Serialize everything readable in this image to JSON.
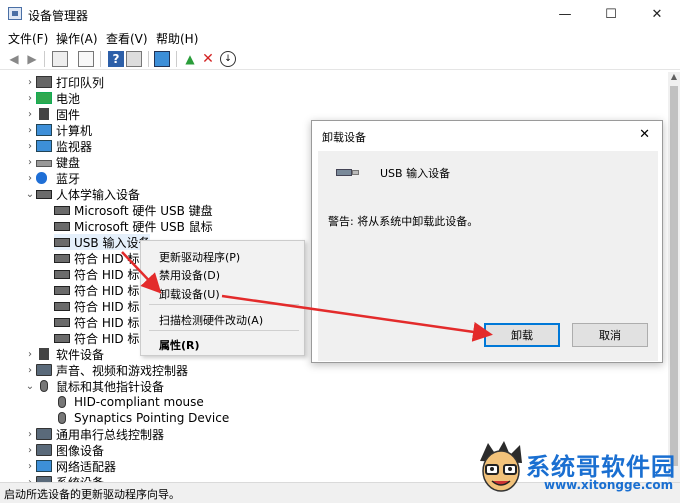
{
  "window": {
    "title": "设备管理器",
    "minimize_glyph": "—",
    "maximize_glyph": "☐",
    "close_glyph": "✕"
  },
  "menubar": {
    "items": [
      "文件(F)",
      "操作(A)",
      "查看(V)",
      "帮助(H)"
    ]
  },
  "toolbar": {
    "buttons": [
      "back-icon",
      "forward-icon",
      "properties-icon",
      "console-icon",
      "help-icon",
      "update-driver-icon",
      "monitor-icon",
      "enable-icon",
      "uninstall-icon",
      "disable-icon"
    ]
  },
  "tree": {
    "rows": [
      {
        "label": "打印队列",
        "expander": "›",
        "icon": "printer-icon"
      },
      {
        "label": "电池",
        "expander": "›",
        "icon": "battery-icon"
      },
      {
        "label": "固件",
        "expander": "›",
        "icon": "firmware-icon"
      },
      {
        "label": "计算机",
        "expander": "›",
        "icon": "computer-icon"
      },
      {
        "label": "监视器",
        "expander": "›",
        "icon": "monitor-icon"
      },
      {
        "label": "键盘",
        "expander": "›",
        "icon": "keyboard-icon"
      },
      {
        "label": "蓝牙",
        "expander": "›",
        "icon": "bluetooth-icon"
      },
      {
        "label": "人体学输入设备",
        "expander": "⌄",
        "icon": "hid-icon"
      },
      {
        "label": "Microsoft 硬件 USB 键盘",
        "expander": "",
        "icon": "hid-device-icon"
      },
      {
        "label": "Microsoft 硬件 USB 鼠标",
        "expander": "",
        "icon": "hid-device-icon"
      },
      {
        "label": "USB 输入设备",
        "expander": "",
        "icon": "hid-device-icon"
      },
      {
        "label": "符合 HID 标",
        "expander": "",
        "icon": "hid-device-icon"
      },
      {
        "label": "符合 HID 标",
        "expander": "",
        "icon": "hid-device-icon"
      },
      {
        "label": "符合 HID 标",
        "expander": "",
        "icon": "hid-device-icon"
      },
      {
        "label": "符合 HID 标",
        "expander": "",
        "icon": "hid-device-icon"
      },
      {
        "label": "符合 HID 标",
        "expander": "",
        "icon": "hid-device-icon"
      },
      {
        "label": "符合 HID 标",
        "expander": "",
        "icon": "hid-device-icon"
      },
      {
        "label": "软件设备",
        "expander": "›",
        "icon": "software-device-icon"
      },
      {
        "label": "声音、视频和游戏控制器",
        "expander": "›",
        "icon": "speaker-icon"
      },
      {
        "label": "鼠标和其他指针设备",
        "expander": "⌄",
        "icon": "mouse-icon"
      },
      {
        "label": "HID-compliant mouse",
        "expander": "",
        "icon": "mouse-icon"
      },
      {
        "label": "Synaptics Pointing Device",
        "expander": "",
        "icon": "mouse-icon"
      },
      {
        "label": "通用串行总线控制器",
        "expander": "›",
        "icon": "usb-controller-icon"
      },
      {
        "label": "图像设备",
        "expander": "›",
        "icon": "camera-icon"
      },
      {
        "label": "网络适配器",
        "expander": "›",
        "icon": "network-icon"
      },
      {
        "label": "系统设备",
        "expander": "›",
        "icon": "system-device-icon"
      }
    ]
  },
  "context_menu": {
    "items": [
      "更新驱动程序(P)",
      "禁用设备(D)",
      "卸载设备(U)",
      "扫描检测硬件改动(A)",
      "属性(R)"
    ]
  },
  "dialog": {
    "title": "卸载设备",
    "close_glyph": "✕",
    "device_name": "USB 输入设备",
    "warning": "警告: 将从系统中卸载此设备。",
    "uninstall_label": "卸载",
    "cancel_label": "取消"
  },
  "statusbar": {
    "text": "启动所选设备的更新驱动程序向导。"
  },
  "watermark": {
    "brand": "系统哥软件园",
    "url": "www.xitongge.com"
  },
  "colors": {
    "accent": "#0078d7",
    "arrow": "#e32b2b",
    "watermark": "#1a6fd1"
  }
}
